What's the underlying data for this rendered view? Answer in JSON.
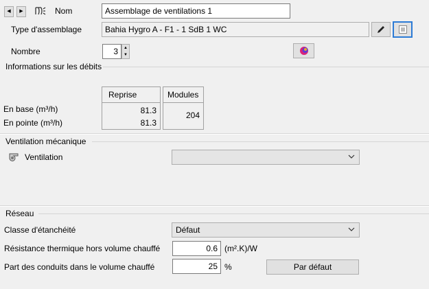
{
  "header": {
    "name_label": "Nom",
    "name_value": "Assemblage de ventilations 1",
    "type_label": "Type d'assemblage",
    "type_value": "Bahia Hygro A - F1 - 1 SdB 1 WC",
    "count_label": "Nombre",
    "count_value": "3",
    "icons": [
      "prev-arrow-icon",
      "next-arrow-icon",
      "fan-icon",
      "edit-pencil-icon",
      "select-window-icon",
      "color-palette-icon"
    ]
  },
  "debits": {
    "section_title": "Informations sur les débits",
    "col_reprise": "Reprise",
    "col_modules": "Modules",
    "row_base_label": "En base (m³/h)",
    "row_pointe_label": "En pointe (m³/h)",
    "reprise_base": "81.3",
    "reprise_pointe": "81.3",
    "modules_value": "204"
  },
  "ventilation": {
    "section_title": "Ventilation mécanique",
    "label": "Ventilation",
    "selected": ""
  },
  "reseau": {
    "section_title": "Réseau",
    "classe_label": "Classe d'étanchéité",
    "classe_value": "Défaut",
    "resistance_label": "Résistance thermique hors volume chauffé",
    "resistance_value": "0.6",
    "resistance_unit": "(m².K)/W",
    "part_label": "Part des conduits dans le volume chauffé",
    "part_value": "25",
    "part_unit": "%",
    "default_button": "Par défaut"
  }
}
